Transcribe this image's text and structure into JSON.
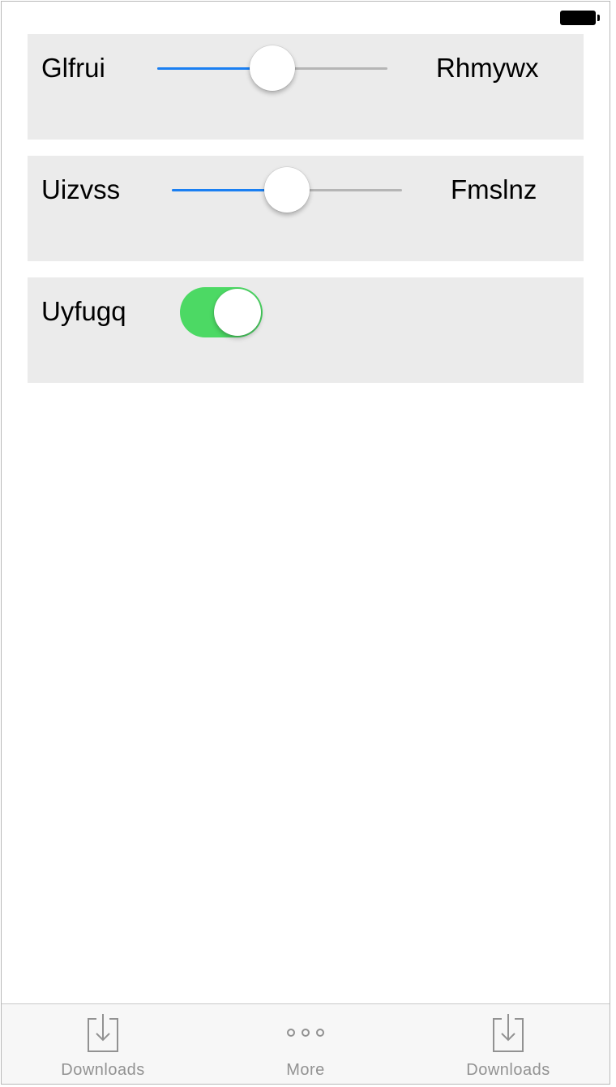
{
  "colors": {
    "row_background": "#ebebeb",
    "slider_fill": "#1a7ff2",
    "slider_track": "#b5b5b5",
    "toggle_on": "#4cd964",
    "tab_inactive": "#929292"
  },
  "rows": [
    {
      "type": "slider",
      "label": "Glfrui",
      "value_label": "Rhmywx",
      "value": 0.5
    },
    {
      "type": "slider",
      "label": "Uizvss",
      "value_label": "Fmslnz",
      "value": 0.5
    },
    {
      "type": "toggle",
      "label": "Uyfugq",
      "on": true
    }
  ],
  "tab_bar": {
    "items": [
      {
        "label": "Downloads",
        "icon": "download-icon"
      },
      {
        "label": "More",
        "icon": "more-icon"
      },
      {
        "label": "Downloads",
        "icon": "download-icon"
      }
    ]
  }
}
